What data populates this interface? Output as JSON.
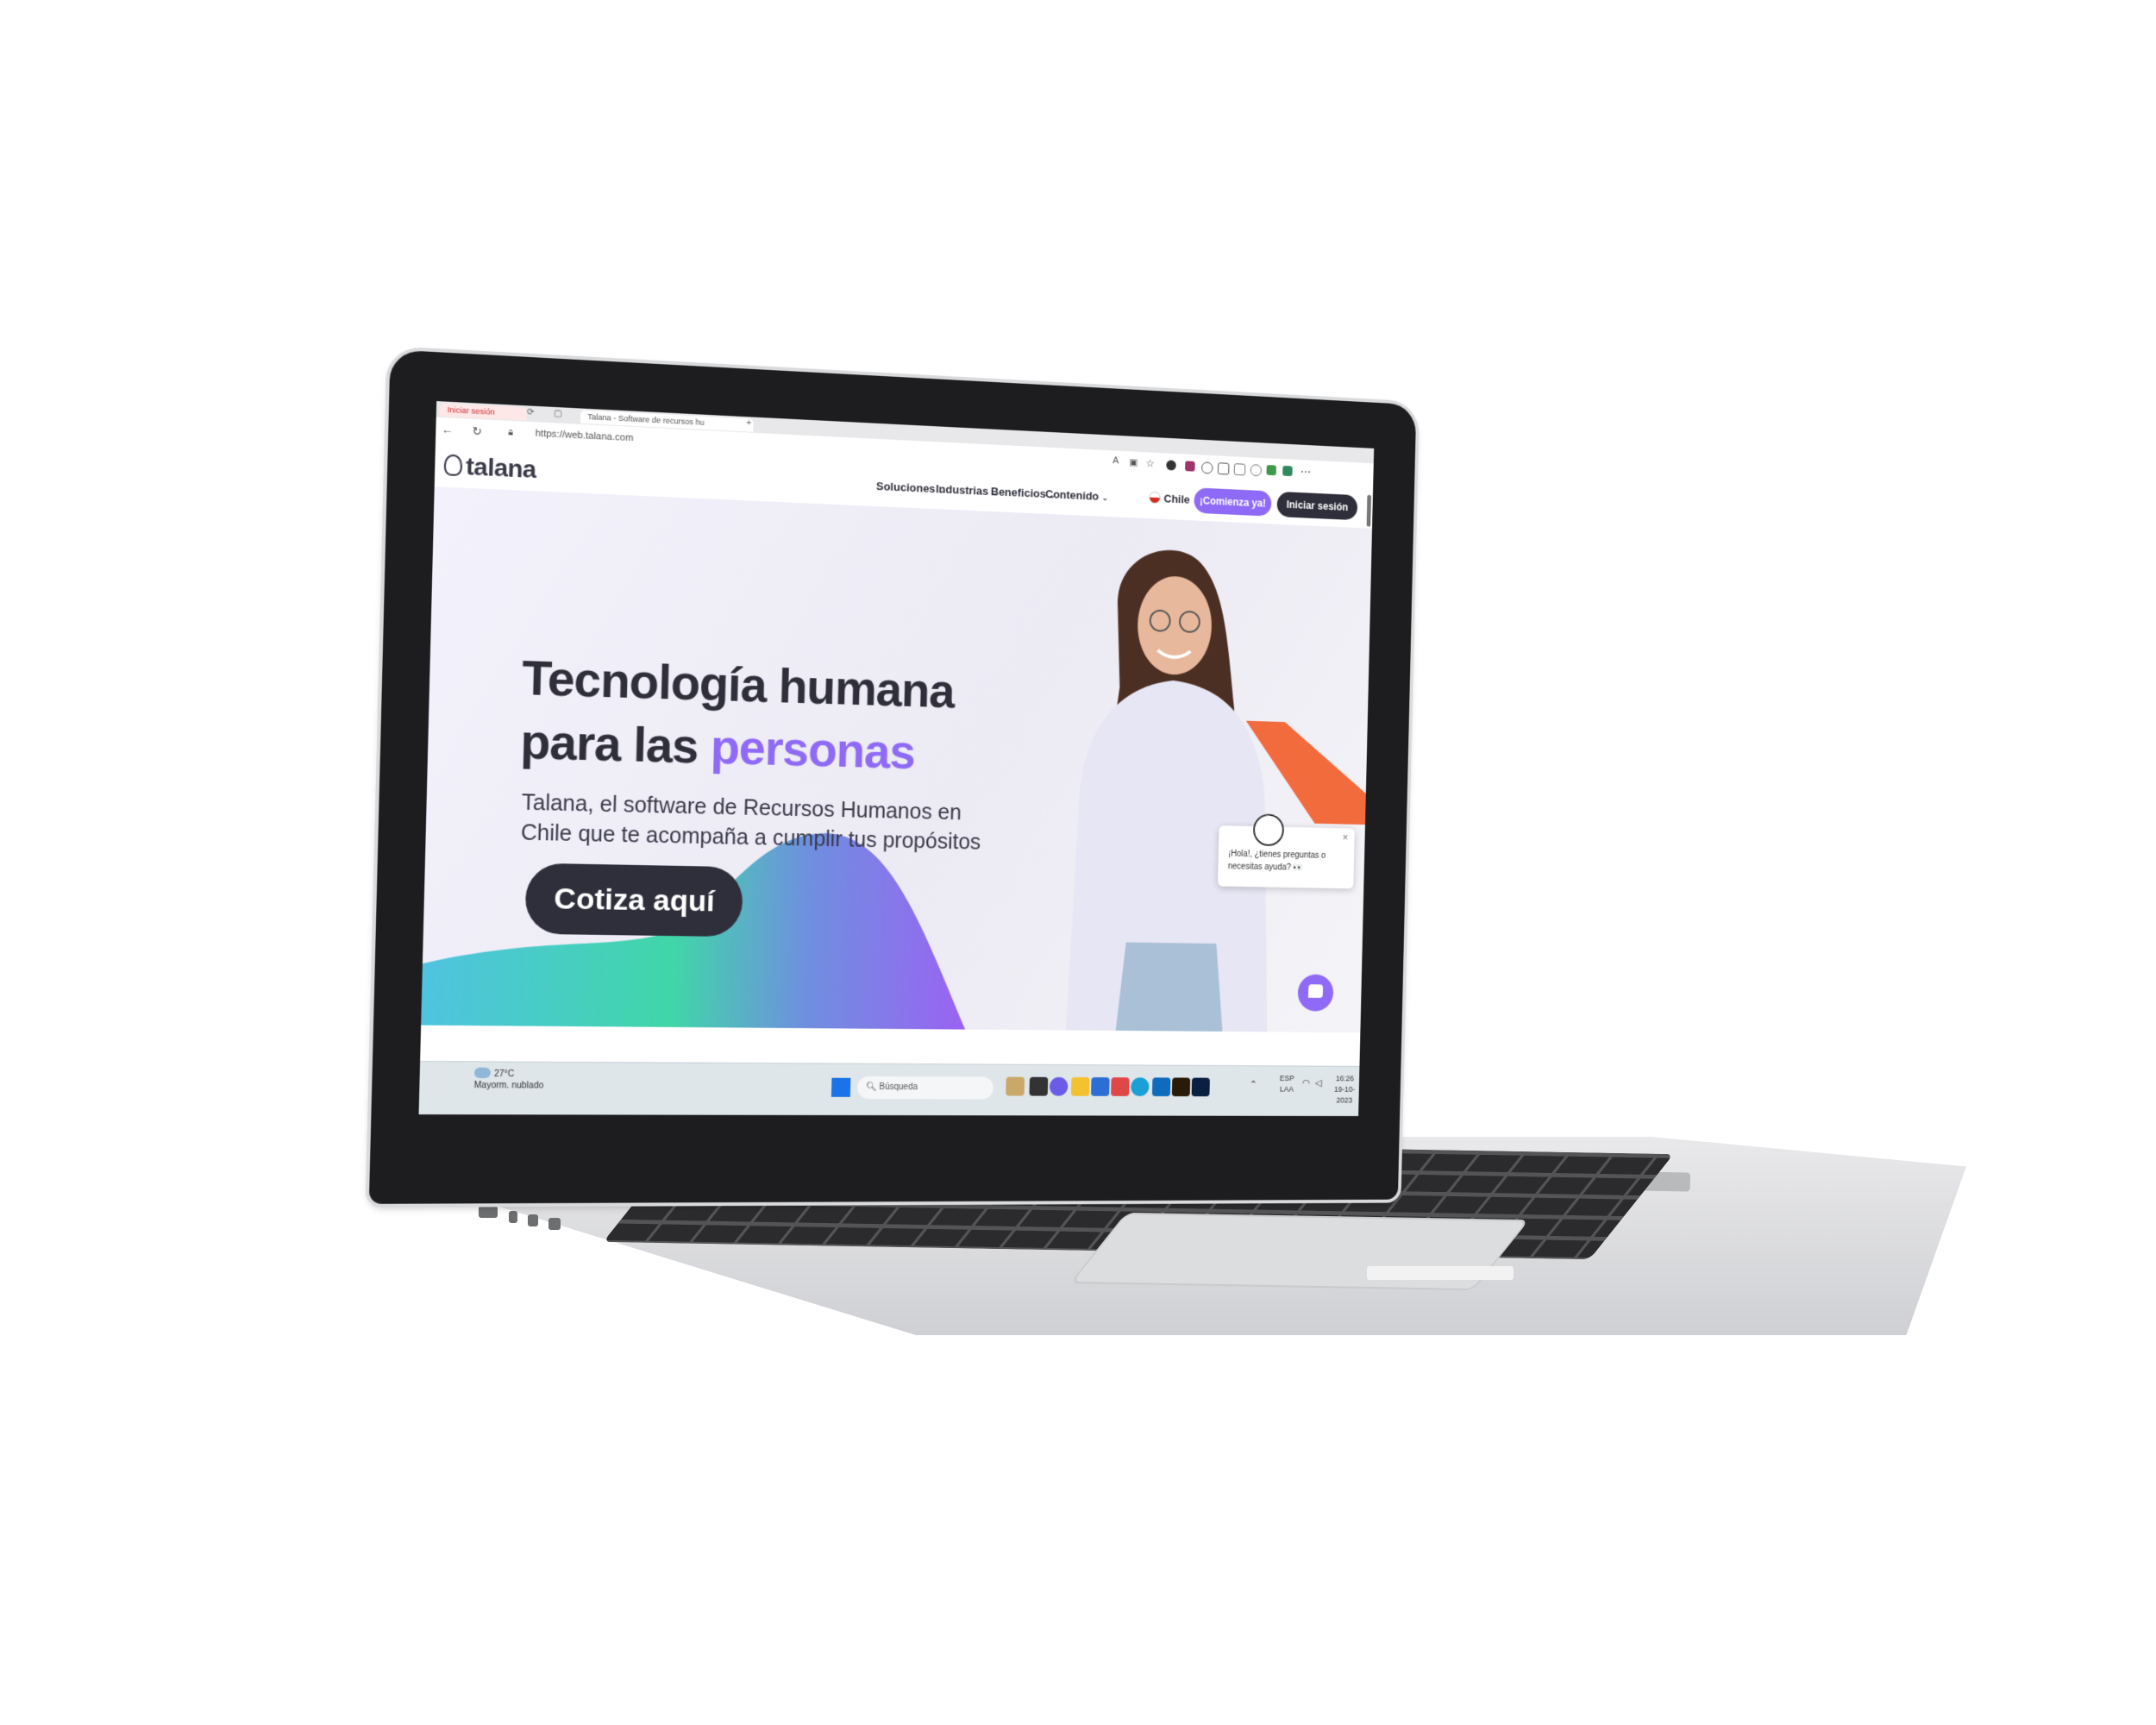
{
  "browser": {
    "tabs": [
      {
        "label": "Iniciar sesión"
      },
      {
        "label": "Talana - Software de recursos hu"
      }
    ],
    "new_tab": "+",
    "url": "https://web.talana.com"
  },
  "site": {
    "logo_text": "talana",
    "nav": [
      {
        "label": "Soluciones"
      },
      {
        "label": "Industrias"
      },
      {
        "label": "Beneficios"
      },
      {
        "label": "Contenido"
      }
    ],
    "country": "Chile",
    "cta_label": "¡Comienza ya!",
    "login_label": "Iniciar sesión"
  },
  "hero": {
    "title_line1": "Tecnología humana",
    "title_line2_prefix": "para las ",
    "title_line2_accent": "personas",
    "subtitle": "Talana, el software de Recursos Humanos en Chile que te acompaña a cumplir tus propósitos",
    "button_label": "Cotiza aquí"
  },
  "chat": {
    "message": "¡Hola!, ¿tienes preguntas o necesitas ayuda? 👀",
    "close": "×"
  },
  "taskbar": {
    "weather_temp": "27°C",
    "weather_desc": "Mayorm. nublado",
    "search_placeholder": "Búsqueda",
    "lang_line1": "ESP",
    "lang_line2": "LAA",
    "time": "16:26",
    "date": "19-10-2023"
  },
  "colors": {
    "accent": "#8f6af6",
    "dark": "#2f2f3b",
    "orange": "#f26b3d"
  }
}
